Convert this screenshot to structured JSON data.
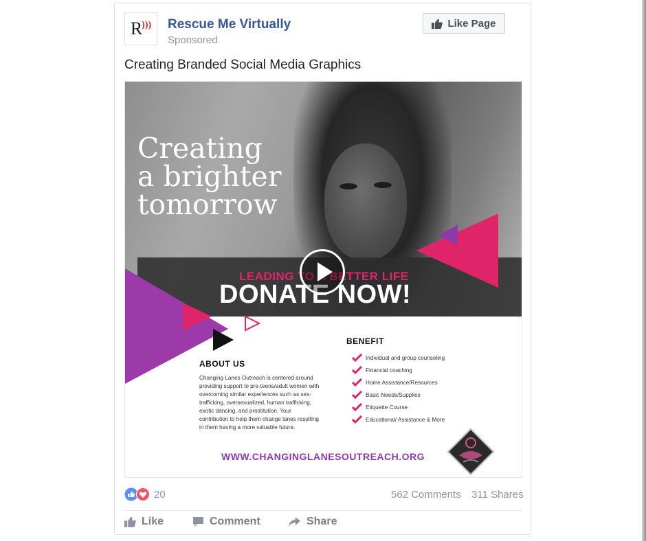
{
  "post": {
    "page_name": "Rescue Me Virtually",
    "sponsored_label": "Sponsored",
    "avatar_letter": "R",
    "like_page_label": "Like Page",
    "text": "Creating Branded Social Media Graphics"
  },
  "graphic": {
    "headline": [
      "Creating",
      "a brighter",
      "tomorrow"
    ],
    "band_subtitle": "LEADING TO A BETTER LIFE",
    "band_title": "DONATE NOW!",
    "about_title": "ABOUT US",
    "about_text": "Changing Lanes Outreach is centered around providing support to pre-teens/adult women with overcoming similar experiences such as sex- trafficking, oversexualized, human trafficking, exotic dancing, and prostitution. Your contribution to help them change lanes resulting in them having a more valuable future.",
    "benefit_title": "BENEFIT",
    "benefits": [
      "Individual and group counseling",
      "Financial coaching",
      "Home Assistance/Resources",
      "Basic Needs/Supplies",
      "Etiquette Course",
      "Educational/ Assistance & More"
    ],
    "website": "WWW.CHANGINGLANESOUTREACH.ORG",
    "colors": {
      "pink": "#e0246a",
      "purple": "#8b3aa8",
      "band": "#2d2d2d"
    }
  },
  "stats": {
    "reaction_count": "20",
    "comments": "562 Comments",
    "shares": "311 Shares"
  },
  "actions": {
    "like": "Like",
    "comment": "Comment",
    "share": "Share"
  },
  "icons": [
    "thumbs-up-icon",
    "play-icon",
    "like-reaction-icon",
    "love-reaction-icon",
    "comment-icon",
    "share-icon",
    "checkmark-icon"
  ]
}
